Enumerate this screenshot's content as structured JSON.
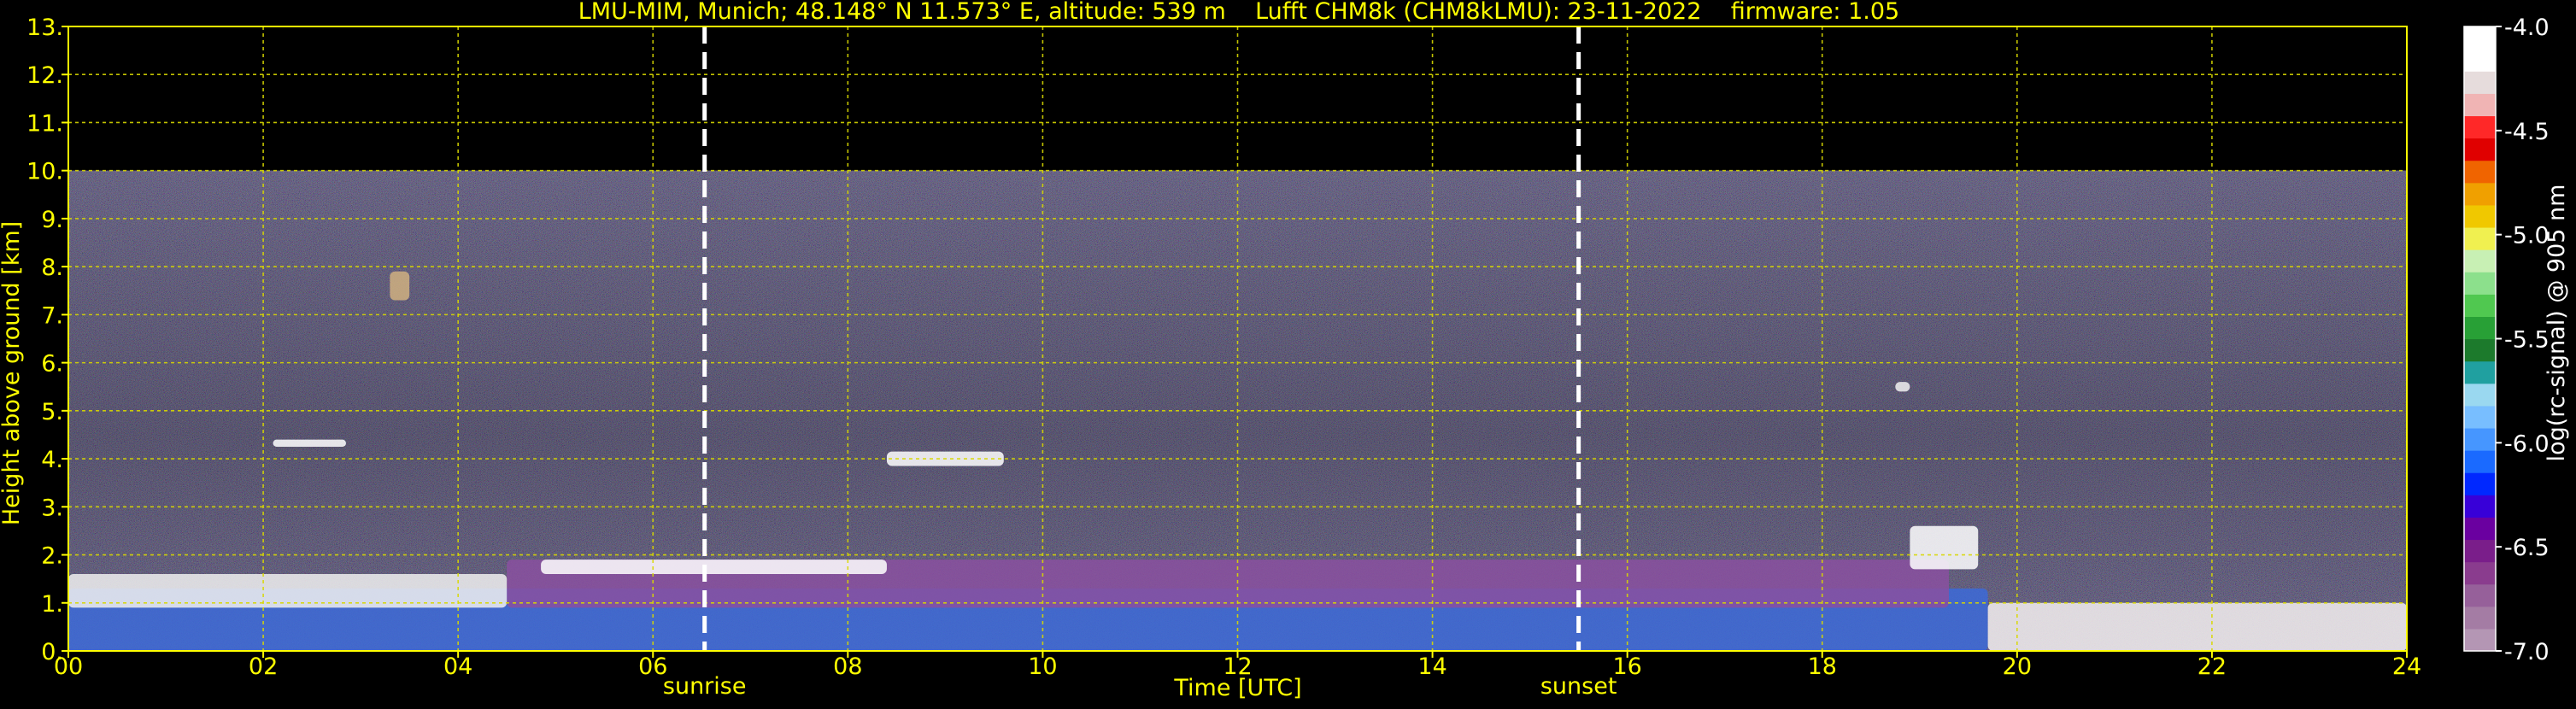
{
  "chart_data": {
    "type": "heatmap",
    "title": "LMU-MIM, Munich; 48.148° N 11.573° E, altitude: 539 m    Lufft CHM8k (CHM8kLMU): 23-11-2022    firmware: 1.05",
    "xlabel": "Time [UTC]",
    "ylabel": "Height above ground [km]",
    "xlim": [
      0,
      24
    ],
    "ylim": [
      0,
      13
    ],
    "x_ticks": [
      "00",
      "02",
      "04",
      "06",
      "08",
      "10",
      "12",
      "14",
      "16",
      "18",
      "20",
      "22",
      "24"
    ],
    "x_tick_values": [
      0,
      2,
      4,
      6,
      8,
      10,
      12,
      14,
      16,
      18,
      20,
      22,
      24
    ],
    "y_ticks": [
      "0.",
      "1.",
      "2.",
      "3.",
      "4.",
      "5.",
      "6.",
      "7.",
      "8.",
      "9.",
      "10.",
      "11.",
      "12.",
      "13."
    ],
    "y_tick_values": [
      0,
      1,
      2,
      3,
      4,
      5,
      6,
      7,
      8,
      9,
      10,
      11,
      12,
      13
    ],
    "grid": true,
    "data_top_height_km": 10,
    "colorbar": {
      "label": "log(rc-signal) @ 905 nm",
      "range": [
        -7.0,
        -4.0
      ],
      "ticks": [
        "-4.0",
        "-4.5",
        "-5.0",
        "-5.5",
        "-6.0",
        "-6.5",
        "-7.0"
      ],
      "tick_values": [
        -4.0,
        -4.5,
        -5.0,
        -5.5,
        -6.0,
        -6.5,
        -7.0
      ],
      "levels": [
        "#b496b4",
        "#a47ca4",
        "#96609a",
        "#8a3c8e",
        "#7a1e8a",
        "#6a00a0",
        "#3800d8",
        "#0028ff",
        "#1a6aff",
        "#4696ff",
        "#78beff",
        "#9ad8f0",
        "#20a0a0",
        "#1c7a2c",
        "#28a036",
        "#50c850",
        "#8ce08c",
        "#c8f0b4",
        "#f0f050",
        "#f0c800",
        "#f0a000",
        "#f06400",
        "#e00000",
        "#ff2828",
        "#f0b4b4",
        "#e6dcdc",
        "#ffffff",
        "#ffffff"
      ]
    },
    "markers": [
      {
        "label": "sunrise",
        "time_hours": 6.53
      },
      {
        "label": "sunset",
        "time_hours": 15.5
      }
    ],
    "colors": {
      "text": "#ffff00",
      "grid": "#d8d800",
      "background": "#000000",
      "noise_dark": "#2a2038"
    },
    "features": [
      {
        "name": "boundary-layer aerosol",
        "t_start": 0.0,
        "t_end": 19.7,
        "h_bottom": 0.0,
        "h_top": 1.3,
        "color": "#3c6ad8"
      },
      {
        "name": "residual layer",
        "t_start": 4.5,
        "t_end": 19.3,
        "h_bottom": 0.9,
        "h_top": 1.9,
        "color": "#8a50a0"
      },
      {
        "name": "low cloud",
        "t_start": 0.0,
        "t_end": 4.5,
        "h_bottom": 0.9,
        "h_top": 1.6,
        "color": "#f0f0f0"
      },
      {
        "name": "cloud layer",
        "t_start": 4.85,
        "t_end": 8.4,
        "h_bottom": 1.6,
        "h_top": 1.9,
        "color": "#ffffff"
      },
      {
        "name": "elevated cloud",
        "t_start": 8.4,
        "t_end": 9.6,
        "h_bottom": 3.85,
        "h_top": 4.15,
        "color": "#ffffff"
      },
      {
        "name": "thin cloud",
        "t_start": 2.1,
        "t_end": 2.85,
        "h_bottom": 4.25,
        "h_top": 4.4,
        "color": "#ffffff"
      },
      {
        "name": "cloud patch",
        "t_start": 3.3,
        "t_end": 3.5,
        "h_bottom": 7.3,
        "h_top": 7.9,
        "color": "#d0b080"
      },
      {
        "name": "evening cloud",
        "t_start": 18.9,
        "t_end": 19.6,
        "h_bottom": 1.7,
        "h_top": 2.6,
        "color": "#ffffff"
      },
      {
        "name": "fog / low cloud",
        "t_start": 19.7,
        "t_end": 24.0,
        "h_bottom": 0.0,
        "h_top": 1.0,
        "color": "#f4f0f0"
      },
      {
        "name": "cloud patch",
        "t_start": 18.75,
        "t_end": 18.9,
        "h_bottom": 5.4,
        "h_top": 5.6,
        "color": "#f0f0f0"
      }
    ]
  }
}
